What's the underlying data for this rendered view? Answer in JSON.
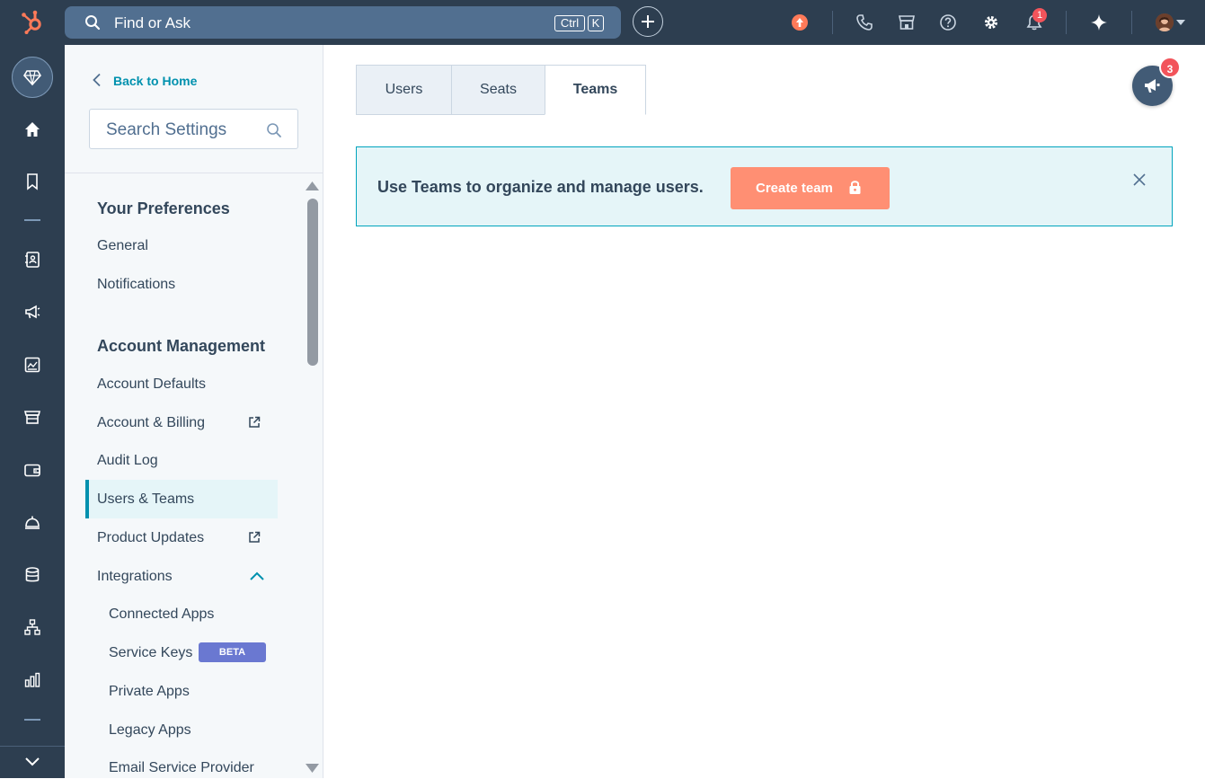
{
  "topbar": {
    "search_placeholder": "Find or Ask",
    "shortcut_keys": [
      "Ctrl",
      "K"
    ],
    "notification_count": "1"
  },
  "sidebar": {
    "back_label": "Back to Home",
    "search_placeholder": "Search Settings",
    "sections": [
      {
        "title": "Your Preferences",
        "items": [
          "General",
          "Notifications"
        ]
      },
      {
        "title": "Account Management",
        "items": [
          "Account Defaults",
          "Account & Billing",
          "Audit Log",
          "Users & Teams",
          "Product Updates",
          "Integrations"
        ],
        "subitems": [
          "Connected Apps",
          "Service Keys",
          "Private Apps",
          "Legacy Apps",
          "Email Service Provider"
        ]
      }
    ],
    "active_item": "Users & Teams",
    "beta_label": "BETA"
  },
  "main": {
    "tabs": [
      "Users",
      "Seats",
      "Teams"
    ],
    "active_tab": "Teams",
    "banner": {
      "text": "Use Teams to organize and manage users.",
      "button_label": "Create team"
    },
    "announcement_count": "3"
  },
  "colors": {
    "topbar_bg": "#2d3e50",
    "search_bg": "#516f90",
    "accent_teal": "#0091ae",
    "banner_bg": "#e5f5f8",
    "banner_border": "#00a4bd",
    "create_button": "#ff8f73",
    "badge_red": "#f2545b",
    "beta_badge": "#6a78d1",
    "hubspot_orange": "#ff7a59"
  }
}
